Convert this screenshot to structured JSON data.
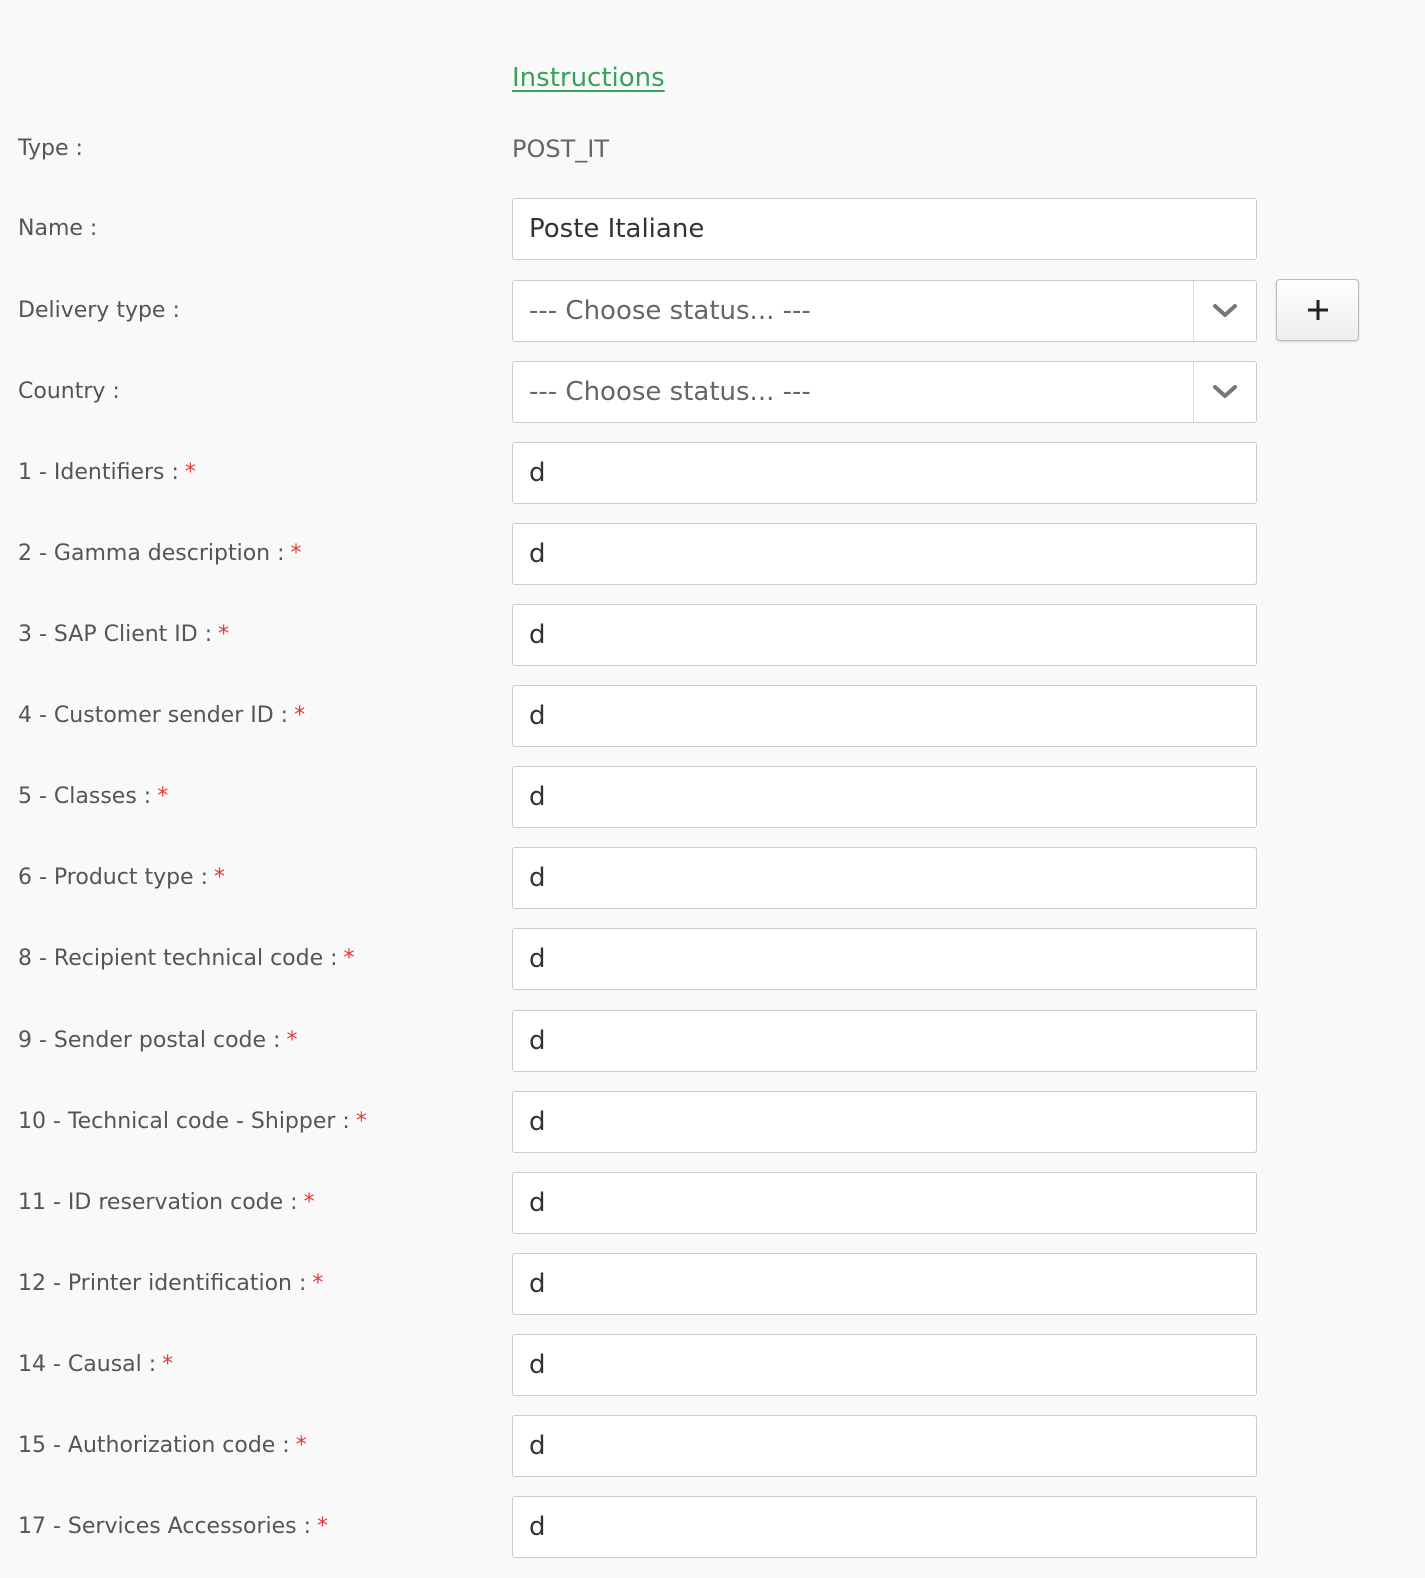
{
  "instructions_link": "Instructions",
  "type_row": {
    "label": "Type :",
    "value": "POST_IT"
  },
  "name_row": {
    "label": "Name :",
    "value": "Poste Italiane"
  },
  "delivery_row": {
    "label": "Delivery type :",
    "selected": "--- Choose status... ---",
    "add_label": "+"
  },
  "country_row": {
    "label": "Country :",
    "selected": "--- Choose status... ---"
  },
  "required_marker": "*",
  "fields": [
    {
      "label": "1 - Identifiers :",
      "value": "d"
    },
    {
      "label": "2 - Gamma description :",
      "value": "d"
    },
    {
      "label": "3 - SAP Client ID :",
      "value": "d"
    },
    {
      "label": "4 - Customer sender ID :",
      "value": "d"
    },
    {
      "label": "5 - Classes :",
      "value": "d"
    },
    {
      "label": "6 - Product type :",
      "value": "d"
    },
    {
      "label": "8 - Recipient technical code :",
      "value": "d"
    },
    {
      "label": "9 - Sender postal code :",
      "value": "d"
    },
    {
      "label": "10 - Technical code - Shipper :",
      "value": "d"
    },
    {
      "label": "11 - ID reservation code :",
      "value": "d"
    },
    {
      "label": "12 - Printer identification :",
      "value": "d"
    },
    {
      "label": "14 - Causal :",
      "value": "d"
    },
    {
      "label": "15 - Authorization code :",
      "value": "d"
    },
    {
      "label": "17 - Services Accessories :",
      "value": "d"
    }
  ],
  "icons": {
    "dropdown": "chevron-down-icon",
    "add": "plus-icon"
  },
  "colors": {
    "link": "#3aa05a",
    "required": "#e53935",
    "background": "#f9f9f9"
  }
}
